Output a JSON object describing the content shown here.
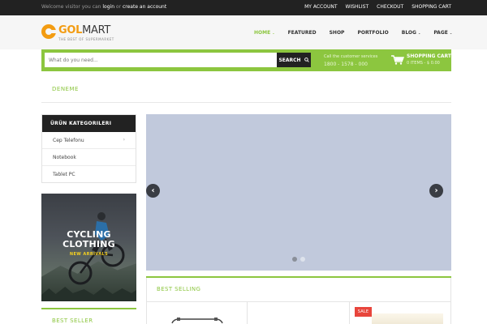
{
  "topbar": {
    "welcome_prefix": "Welcome visitor you can ",
    "login_link": "login",
    "welcome_or": " or ",
    "register_link": "create an account",
    "links": [
      "MY ACCOUNT",
      "WISHLIST",
      "CHECKOUT",
      "SHOPPING CART"
    ]
  },
  "header": {
    "logo_part1": "GOL",
    "logo_part2": "MART",
    "tagline": "THE BEST OF SUPERMARKET",
    "nav": [
      {
        "label": "HOME",
        "caret": "⌄",
        "active": true
      },
      {
        "label": "FEATURED",
        "caret": ""
      },
      {
        "label": "SHOP",
        "caret": ""
      },
      {
        "label": "PORTFOLIO",
        "caret": ""
      },
      {
        "label": "BLOG",
        "caret": "⌄"
      },
      {
        "label": "PAGE",
        "caret": "⌄"
      }
    ]
  },
  "search": {
    "placeholder": "What do you need...",
    "button_label": "SEARCH",
    "call_label": "Call the customer services",
    "phone": "1800 - 1578 - 000",
    "cart_title": "SHOPPING CART",
    "cart_summary": "0 ITEMS - $ 0.00"
  },
  "breadcrumb": {
    "title": "DENEME"
  },
  "categories": {
    "title": "ÜRÜN KATEGORILERI",
    "items": [
      {
        "label": "Cep Telefonu",
        "chevron": "›"
      },
      {
        "label": "Notebook",
        "chevron": ""
      },
      {
        "label": "Tablet PC",
        "chevron": ""
      }
    ]
  },
  "banner": {
    "title_line1": "CYCLING",
    "title_line2": "CLOTHING",
    "subtitle": "NEW ARRIVALS"
  },
  "sidebar_bottom": {
    "title": "BEST SELLER"
  },
  "slider": {
    "prev": "‹",
    "next": "›",
    "slide_count": 2,
    "active_index": 0
  },
  "best_selling": {
    "title": "BEST SELLING",
    "sale_badge": "SALE"
  },
  "colors": {
    "accent": "#8cc63f",
    "logo": "#f39c12",
    "dark": "#222222",
    "sale": "#e8453c"
  }
}
